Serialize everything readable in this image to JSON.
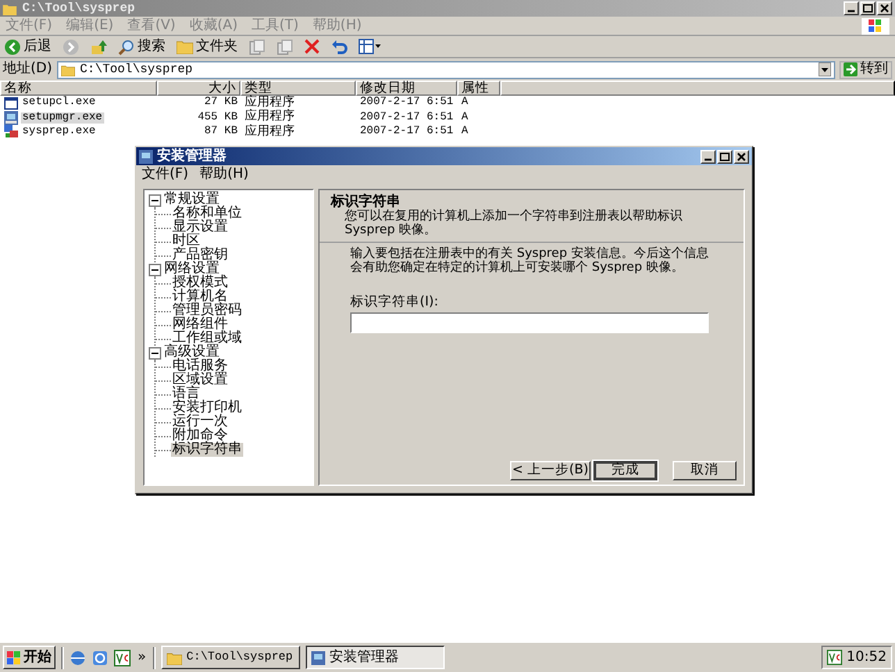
{
  "explorer": {
    "title": "C:\\Tool\\sysprep",
    "menu": [
      "文件(F)",
      "编辑(E)",
      "查看(V)",
      "收藏(A)",
      "工具(T)",
      "帮助(H)"
    ],
    "toolbar": [
      {
        "kind": "back",
        "label": "后退"
      },
      {
        "kind": "forward"
      },
      {
        "kind": "up"
      },
      {
        "kind": "search",
        "label": "搜索"
      },
      {
        "kind": "folders",
        "label": "文件夹"
      },
      {
        "kind": "move"
      },
      {
        "kind": "copy"
      },
      {
        "kind": "delete"
      },
      {
        "kind": "undo"
      },
      {
        "kind": "views"
      }
    ],
    "address": {
      "label": "地址(D)",
      "value": "C:\\Tool\\sysprep",
      "go": "转到"
    },
    "columns": [
      "名称",
      "大小",
      "类型",
      "修改日期",
      "属性"
    ],
    "files": [
      {
        "name": "setupcl.exe",
        "size": "27 KB",
        "type": "应用程序",
        "modified": "2007-2-17 6:51",
        "attributes": "A",
        "selected": false
      },
      {
        "name": "setupmgr.exe",
        "size": "455 KB",
        "type": "应用程序",
        "modified": "2007-2-17 6:51",
        "attributes": "A",
        "selected": true
      },
      {
        "name": "sysprep.exe",
        "size": "87 KB",
        "type": "应用程序",
        "modified": "2007-2-17 6:51",
        "attributes": "A",
        "selected": false
      }
    ]
  },
  "dialog": {
    "title": "安装管理器",
    "menu": [
      "文件(F)",
      "帮助(H)"
    ],
    "tree": [
      {
        "label": "常规设置",
        "expanded": true,
        "children": [
          {
            "label": "名称和单位",
            "selected": false
          },
          {
            "label": "显示设置",
            "selected": false
          },
          {
            "label": "时区",
            "selected": false
          },
          {
            "label": "产品密钥",
            "selected": false
          }
        ]
      },
      {
        "label": "网络设置",
        "expanded": true,
        "children": [
          {
            "label": "授权模式",
            "selected": false
          },
          {
            "label": "计算机名",
            "selected": false
          },
          {
            "label": "管理员密码",
            "selected": false
          },
          {
            "label": "网络组件",
            "selected": false
          },
          {
            "label": "工作组或域",
            "selected": false
          }
        ]
      },
      {
        "label": "高级设置",
        "expanded": true,
        "children": [
          {
            "label": "电话服务",
            "selected": false
          },
          {
            "label": "区域设置",
            "selected": false
          },
          {
            "label": "语言",
            "selected": false
          },
          {
            "label": "安装打印机",
            "selected": false
          },
          {
            "label": "运行一次",
            "selected": false
          },
          {
            "label": "附加命令",
            "selected": false
          },
          {
            "label": "标识字符串",
            "selected": true
          }
        ]
      }
    ],
    "heading": "标识字符串",
    "subheading": "您可以在复用的计算机上添加一个字符串到注册表以帮助标识 Sysprep 映像。",
    "description": "输入要包括在注册表中的有关 Sysprep 安装信息。今后这个信息会有助您确定在特定的计算机上可安装哪个 Sysprep 映像。",
    "field_label": "标识字符串(I):",
    "buttons": [
      {
        "label": "< 上一步(B)",
        "default": false
      },
      {
        "label": "完成",
        "default": true
      },
      {
        "label": "取消",
        "default": false
      }
    ]
  },
  "taskbar": {
    "start": "开始",
    "more": "»",
    "tasks": [
      {
        "label": "C:\\Tool\\sysprep",
        "kind": "folder",
        "active": false
      },
      {
        "label": "安装管理器",
        "kind": "app",
        "active": true
      }
    ],
    "clock": "10:52"
  }
}
